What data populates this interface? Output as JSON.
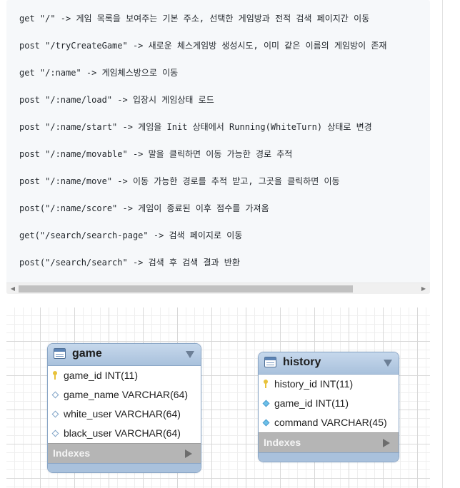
{
  "code": {
    "lines": [
      "get \"/\" -> 게임 목록을 보여주는 기본 주소, 선택한 게임방과 전적 검색 페이지간 이동",
      "post \"/tryCreateGame\" -> 새로운 체스게임방 생성시도, 이미 같은 이름의 게임방이 존재",
      "get \"/:name\" -> 게임체스방으로 이동",
      "post \"/:name/load\" -> 입장시 게임상태 로드",
      "post \"/:name/start\" -> 게임을 Init 상태에서 Running(WhiteTurn) 상태로 변경",
      "post \"/:name/movable\" -> 말을 클릭하면 이동 가능한 경로 추적",
      "post \"/:name/move\" -> 이동 가능한 경로를 추적 받고, 그곳을 클릭하면 이동",
      "post(\"/:name/score\" -> 게임이 종료된 이후 점수를 가져옴",
      "get(\"/search/search-page\" -> 검색 페이지로 이동",
      "post(\"/search/search\" -> 검색 후 검색 결과 반환"
    ],
    "scroll_left_glyph": "◀",
    "scroll_right_glyph": "▶"
  },
  "diagram": {
    "game": {
      "name": "game",
      "columns": [
        {
          "text": "game_id INT(11)",
          "icon": "primary-key-icon"
        },
        {
          "text": "game_name VARCHAR(64)",
          "icon": "column-diamond-icon"
        },
        {
          "text": "white_user VARCHAR(64)",
          "icon": "column-diamond-icon"
        },
        {
          "text": "black_user VARCHAR(64)",
          "icon": "column-diamond-icon"
        }
      ],
      "indexes_label": "Indexes"
    },
    "history": {
      "name": "history",
      "columns": [
        {
          "text": "history_id INT(11)",
          "icon": "primary-key-icon"
        },
        {
          "text": "game_id INT(11)",
          "icon": "foreign-key-diamond-icon"
        },
        {
          "text": "command VARCHAR(45)",
          "icon": "foreign-key-diamond-icon"
        }
      ],
      "indexes_label": "Indexes"
    }
  }
}
